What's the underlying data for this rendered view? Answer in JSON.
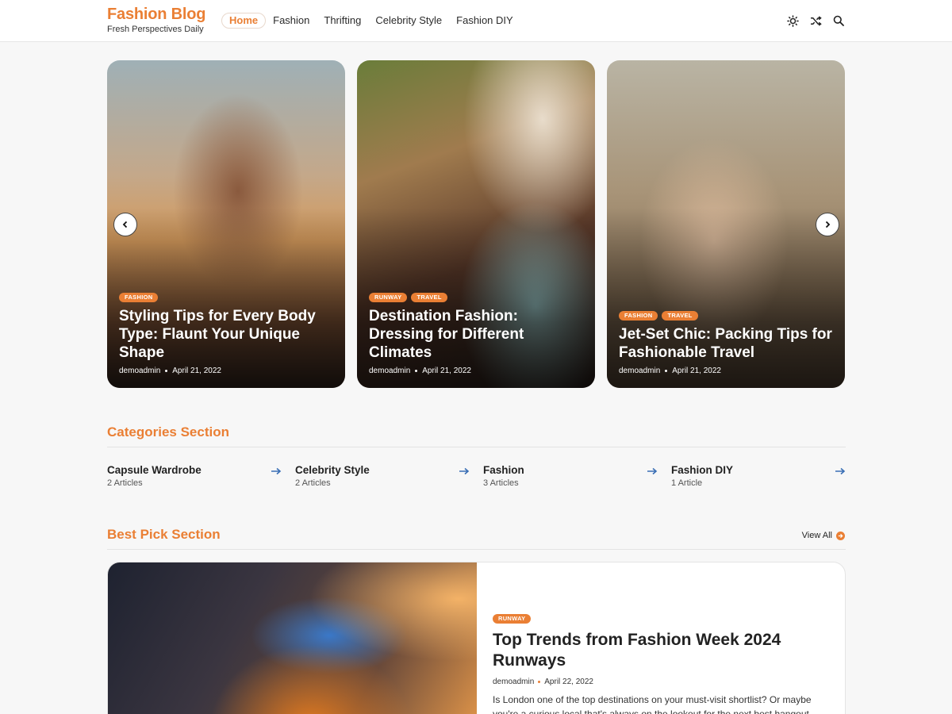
{
  "brand": {
    "title": "Fashion Blog",
    "tagline": "Fresh Perspectives Daily"
  },
  "nav": {
    "items": [
      "Home",
      "Fashion",
      "Thrifting",
      "Celebrity Style",
      "Fashion DIY"
    ]
  },
  "header_icons": [
    "sun-icon",
    "shuffle-icon",
    "search-icon"
  ],
  "slides": [
    {
      "tags": [
        "FASHION"
      ],
      "title": "Styling Tips for Every Body Type: Flaunt Your Unique Shape",
      "author": "demoadmin",
      "date": "April 21, 2022"
    },
    {
      "tags": [
        "RUNWAY",
        "TRAVEL"
      ],
      "title": "Destination Fashion: Dressing for Different Climates",
      "author": "demoadmin",
      "date": "April 21, 2022"
    },
    {
      "tags": [
        "FASHION",
        "TRAVEL"
      ],
      "title": "Jet-Set Chic: Packing Tips for Fashionable Travel",
      "author": "demoadmin",
      "date": "April 21, 2022"
    }
  ],
  "categories_section": {
    "title": "Categories Section",
    "items": [
      {
        "name": "Capsule Wardrobe",
        "count": "2 Articles"
      },
      {
        "name": "Celebrity Style",
        "count": "2 Articles"
      },
      {
        "name": "Fashion",
        "count": "3 Articles"
      },
      {
        "name": "Fashion DIY",
        "count": "1 Article"
      }
    ]
  },
  "best_pick": {
    "title": "Best Pick Section",
    "view_all": "View All",
    "post": {
      "tag": "RUNWAY",
      "title": "Top Trends from Fashion Week 2024 Runways",
      "author": "demoadmin",
      "date": "April 22, 2022",
      "excerpt": "Is London one of the top destinations on your must-visit shortlist? Or maybe you're a curious local that's always on the lookout for the next best hangout"
    }
  },
  "colors": {
    "accent": "#ea7f34",
    "arrow": "#3a6fb5"
  }
}
